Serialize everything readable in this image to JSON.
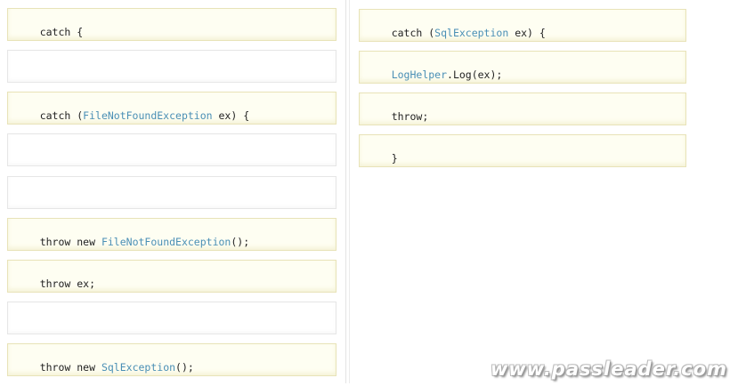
{
  "left_slots": [
    {
      "parts": [
        {
          "t": "catch {",
          "k": "plain"
        }
      ]
    },
    {
      "parts": []
    },
    {
      "parts": [
        {
          "t": "catch (",
          "k": "plain"
        },
        {
          "t": "FileNotFoundException",
          "k": "type"
        },
        {
          "t": " ex) {",
          "k": "plain"
        }
      ]
    },
    {
      "parts": []
    },
    {
      "parts": []
    },
    {
      "parts": [
        {
          "t": "throw new ",
          "k": "plain"
        },
        {
          "t": "FileNotFoundException",
          "k": "type"
        },
        {
          "t": "();",
          "k": "plain"
        }
      ]
    },
    {
      "parts": [
        {
          "t": "throw ex;",
          "k": "plain"
        }
      ]
    },
    {
      "parts": []
    },
    {
      "parts": [
        {
          "t": "throw new ",
          "k": "plain"
        },
        {
          "t": "SqlException",
          "k": "type"
        },
        {
          "t": "();",
          "k": "plain"
        }
      ]
    }
  ],
  "right_slots": [
    {
      "parts": [
        {
          "t": "catch (",
          "k": "plain"
        },
        {
          "t": "SqlException",
          "k": "type"
        },
        {
          "t": " ex) {",
          "k": "plain"
        }
      ]
    },
    {
      "parts": [
        {
          "t": "LogHelper",
          "k": "type"
        },
        {
          "t": ".Log(ex);",
          "k": "plain"
        }
      ]
    },
    {
      "parts": [
        {
          "t": "throw;",
          "k": "plain"
        }
      ]
    },
    {
      "parts": [
        {
          "t": "}",
          "k": "plain"
        }
      ]
    }
  ],
  "watermark": "www.passleader.com"
}
